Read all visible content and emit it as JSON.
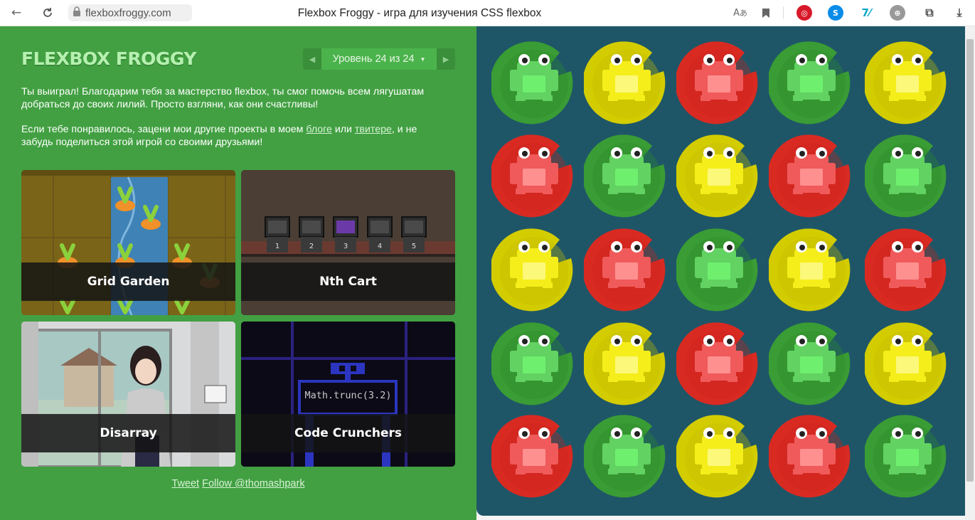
{
  "browser": {
    "url": "flexboxfroggy.com",
    "title": "Flexbox Froggy - игра для изучения CSS flexbox",
    "icons": [
      "back-icon",
      "reload-icon",
      "lock-icon",
      "translate-icon",
      "bookmark-icon",
      "opera-ext-icon",
      "shazam-ext-icon",
      "seven-ext-icon",
      "globe-ext-icon",
      "collections-icon",
      "download-icon"
    ]
  },
  "game": {
    "logo": "FLEXBOX FROGGY",
    "level_label": "Уровень 24 из 24",
    "win_text": "Ты выиграл! Благодарим тебя за мастерство flexbox, ты смог помочь всем лягушатам добраться до своих лилий. Просто взгляни, как они счастливы!",
    "projects_text_before": "Если тебе понравилось, зацени мои другие проекты в моем ",
    "blog_link": "блоге",
    "projects_text_mid": " или ",
    "twitter_link": "твитере",
    "projects_text_after": ", и не забудь поделиться этой игрой со своими друзьями!",
    "projects": [
      {
        "title": "Grid Garden"
      },
      {
        "title": "Nth Cart",
        "cart_numbers": [
          "1",
          "2",
          "3",
          "4",
          "5"
        ]
      },
      {
        "title": "Disarray"
      },
      {
        "title": "Code Crunchers",
        "code": "Math.trunc(3.2)"
      }
    ],
    "tweet_link": "Tweet",
    "follow_link": "Follow @thomashpark"
  },
  "pond": {
    "colors": {
      "green": "#3a9c34",
      "yellow": "#d3cc00",
      "red": "#d92a22"
    },
    "grid": [
      [
        "green",
        "yellow",
        "red",
        "green",
        "yellow"
      ],
      [
        "red",
        "green",
        "yellow",
        "red",
        "green"
      ],
      [
        "yellow",
        "red",
        "green",
        "yellow",
        "red"
      ],
      [
        "green",
        "yellow",
        "red",
        "green",
        "yellow"
      ],
      [
        "red",
        "green",
        "yellow",
        "red",
        "green"
      ]
    ]
  }
}
